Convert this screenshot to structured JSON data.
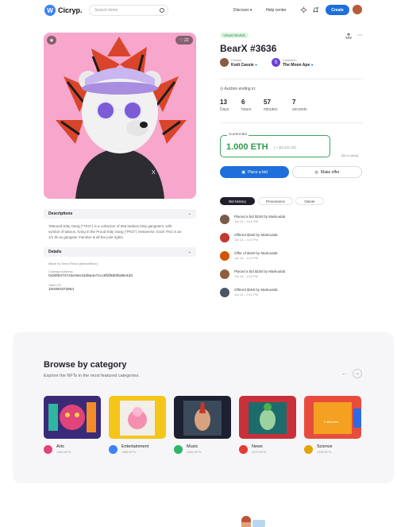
{
  "header": {
    "brand": "Cicryp.",
    "search_placeholder": "Search items",
    "nav_discover": "Discover",
    "nav_help": "Help center",
    "create_label": "Create"
  },
  "artwork": {
    "views": "",
    "likes": "22",
    "background_color": "#f7a6cc"
  },
  "description": {
    "heading": "Descriptions",
    "text_line1": "Tattooed Kitty Gang (\"TKG\") is a collection of 666 badass Kitty gangsters, with",
    "text_line2": "symbol of tattoos, living in the Proud Kitty Gang (\"PKG\") metaverse. Each TKG is an",
    "text_line3": "1/1 ID as gangster member & all the joint rights."
  },
  "details": {
    "heading": "Details",
    "made_by_label": "Made by Sean Rossi (@sean80xx)",
    "contract_label": "Contract Address",
    "contract_value": "0x50f5474724e0ee42d9a4e71cc8f2f56bf5d9e4d3",
    "token_label": "Token ID",
    "token_value": "100300372864"
  },
  "item": {
    "tag": "Virtual Worlds",
    "title": "BearX #3636",
    "creator_label": "Creator",
    "creator_name": "Kodi Cassie",
    "collection_label": "Collection",
    "collection_name": "The Moon Ape",
    "auction_label": "Auction ending in:",
    "countdown": [
      {
        "value": "13",
        "label": "Days"
      },
      {
        "value": "6",
        "label": "hours"
      },
      {
        "value": "57",
        "label": "minutes"
      },
      {
        "value": "7",
        "label": "seconds"
      }
    ],
    "current_bid_label": "Current Bid",
    "current_bid_value": "1.000 ETH",
    "current_bid_usd": "( ≈ $3,221.22)",
    "stock_note": "[96 in stock]",
    "place_bid_label": "Place a bid",
    "make_offer_label": "Make offer"
  },
  "tabs": [
    "Bid History",
    "Provenance",
    "Owner"
  ],
  "history": [
    {
      "line1": "Placed a bid $150 by Markoulab",
      "line2": "Jun 14 – 4:12 PM",
      "color": "#7a5a4a"
    },
    {
      "line1": "Offered $150 by Markoulab",
      "line2": "Jun 14 – 4:12 PM",
      "color": "#c0392b"
    },
    {
      "line1": "Offer of $150 by Markoulab",
      "line2": "Jun 14 – 4:12 PM",
      "color": "#d35400"
    },
    {
      "line1": "Placed a bid $150 by Markoulab",
      "line2": "Jun 14 – 4:12 PM",
      "color": "#8e5e3e"
    },
    {
      "line1": "Offered $150 by Markoulab",
      "line2": "Jun 14 – 4:12 PM",
      "color": "#4a5568"
    }
  ],
  "browse": {
    "title": "Browse by category",
    "subtitle": "Explore the NFTs in the most featured categories.",
    "categories": [
      {
        "name": "Arts",
        "count": "1456 NFTs",
        "dot": "#e0447a"
      },
      {
        "name": "Entertainment",
        "count": "1586 NFTs",
        "dot": "#3b82f6"
      },
      {
        "name": "Music",
        "count": "1596 NFTs",
        "dot": "#2fb56a"
      },
      {
        "name": "News",
        "count": "1173 NFTs",
        "dot": "#e53935"
      },
      {
        "name": "Science",
        "count": "1096 NFTs",
        "dot": "#e2a400"
      }
    ],
    "science_card_text": "Fullscreen"
  }
}
